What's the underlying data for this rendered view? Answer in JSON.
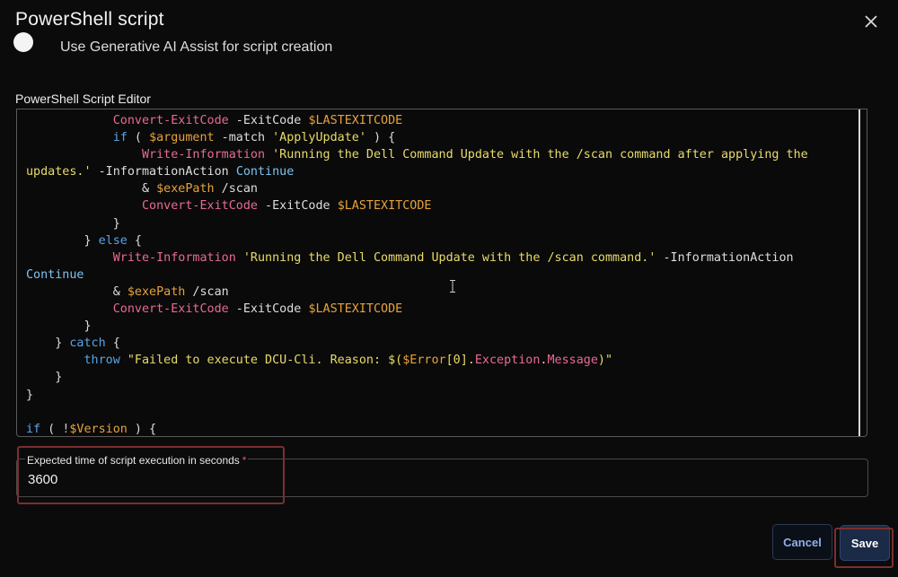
{
  "dialog": {
    "title": "PowerShell script",
    "close_icon": "close-icon"
  },
  "ai_assist": {
    "label": "Use Generative AI Assist for script creation",
    "enabled": false
  },
  "editor": {
    "label": "PowerShell Script Editor",
    "lines": [
      [
        {
          "t": "            "
        },
        {
          "t": "Convert-ExitCode",
          "c": "f"
        },
        {
          "t": " -ExitCode "
        },
        {
          "t": "$LASTEXITCODE",
          "c": "v"
        }
      ],
      [
        {
          "t": "            "
        },
        {
          "t": "if",
          "c": "k"
        },
        {
          "t": " ( "
        },
        {
          "t": "$argument",
          "c": "v"
        },
        {
          "t": " -match "
        },
        {
          "t": "'ApplyUpdate'",
          "c": "s"
        },
        {
          "t": " ) {"
        }
      ],
      [
        {
          "t": "                "
        },
        {
          "t": "Write-Information",
          "c": "f"
        },
        {
          "t": " "
        },
        {
          "t": "'Running the Dell Command Update with the /scan command after applying the",
          "c": "s"
        }
      ],
      [
        {
          "t": "updates.'",
          "c": "s"
        },
        {
          "t": " -InformationAction "
        },
        {
          "t": "Continue",
          "c": "c"
        }
      ],
      [
        {
          "t": "                & "
        },
        {
          "t": "$exePath",
          "c": "v"
        },
        {
          "t": " /scan"
        }
      ],
      [
        {
          "t": "                "
        },
        {
          "t": "Convert-ExitCode",
          "c": "f"
        },
        {
          "t": " -ExitCode "
        },
        {
          "t": "$LASTEXITCODE",
          "c": "v"
        }
      ],
      [
        {
          "t": "            }"
        }
      ],
      [
        {
          "t": "        } "
        },
        {
          "t": "else",
          "c": "k"
        },
        {
          "t": " {"
        }
      ],
      [
        {
          "t": "            "
        },
        {
          "t": "Write-Information",
          "c": "f"
        },
        {
          "t": " "
        },
        {
          "t": "'Running the Dell Command Update with the /scan command.'",
          "c": "s"
        },
        {
          "t": " -InformationAction"
        }
      ],
      [
        {
          "t": "Continue",
          "c": "c"
        }
      ],
      [
        {
          "t": "            & "
        },
        {
          "t": "$exePath",
          "c": "v"
        },
        {
          "t": " /scan"
        }
      ],
      [
        {
          "t": "            "
        },
        {
          "t": "Convert-ExitCode",
          "c": "f"
        },
        {
          "t": " -ExitCode "
        },
        {
          "t": "$LASTEXITCODE",
          "c": "v"
        }
      ],
      [
        {
          "t": "        }"
        }
      ],
      [
        {
          "t": "    } "
        },
        {
          "t": "catch",
          "c": "k"
        },
        {
          "t": " {"
        }
      ],
      [
        {
          "t": "        "
        },
        {
          "t": "throw",
          "c": "k"
        },
        {
          "t": " "
        },
        {
          "t": "\"Failed to execute DCU-Cli. Reason: $(",
          "c": "s"
        },
        {
          "t": "$Error",
          "c": "v"
        },
        {
          "t": "[0].",
          "c": "s"
        },
        {
          "t": "Exception",
          "c": "f"
        },
        {
          "t": ".",
          "c": "s"
        },
        {
          "t": "Message",
          "c": "f"
        },
        {
          "t": ")\"",
          "c": "s"
        }
      ],
      [
        {
          "t": "    }"
        }
      ],
      [
        {
          "t": "}"
        }
      ],
      [
        {
          "t": ""
        }
      ],
      [
        {
          "t": "if",
          "c": "k"
        },
        {
          "t": " ( "
        },
        {
          "t": "!",
          "c": "p"
        },
        {
          "t": "$Version",
          "c": "v"
        },
        {
          "t": " ) {"
        }
      ]
    ]
  },
  "execution_time": {
    "label": "Expected time of script execution in seconds",
    "required_mark": "*",
    "value": "3600"
  },
  "buttons": {
    "cancel": "Cancel",
    "save": "Save"
  },
  "colors": {
    "background": "#0b0b0c",
    "keyword": "#5aa4e6",
    "function": "#e86a94",
    "string": "#e8db6a",
    "variable": "#e7a23a",
    "highlight_box": "#7a2f30"
  }
}
